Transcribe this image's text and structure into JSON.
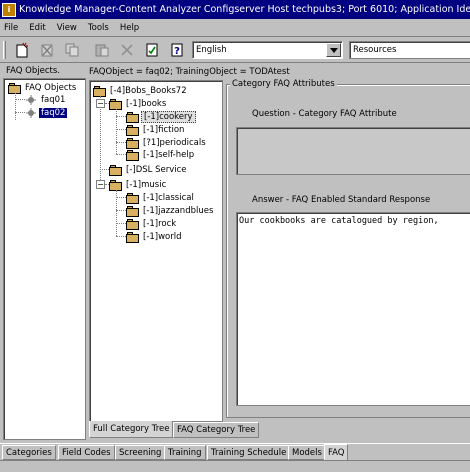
{
  "window": {
    "title": "Knowledge Manager-Content Analyzer Configserver Host techpubs3; Port 6010; Application Iden"
  },
  "menu": [
    "File",
    "Edit",
    "View",
    "Tools",
    "Help"
  ],
  "toolbar": {
    "icons": [
      "new-icon",
      "delete-icon",
      "copy-icon",
      "paste-icon",
      "cut-icon",
      "refresh-icon",
      "help-icon"
    ],
    "language": "English",
    "resources": "Resources"
  },
  "left": {
    "label": "FAQ Objects.",
    "root": "FAQ Objects",
    "items": [
      "faq01",
      "faq02"
    ]
  },
  "header": "FAQObject = faq02; TrainingObject = TODAtest",
  "tree": {
    "root": "[-4]Bobs_Books72",
    "books": "[-1]books",
    "book_items": [
      "[-1]cookery",
      "[-1]fiction",
      "[?1]periodicals",
      "[-1]self-help"
    ],
    "dsl": "[-]DSL Service",
    "music": "[-1]music",
    "music_items": [
      "[-1]classical",
      "[-1]jazzandblues",
      "[-1]rock",
      "[-1]world"
    ]
  },
  "attributes": {
    "legend": "Category FAQ Attributes",
    "question_label": "Question - Category FAQ Attribute",
    "question_value": "",
    "answer_label": "Answer - FAQ Enabled Standard Response",
    "answer_value": "Our cookbooks are catalogued by region,"
  },
  "inner_tabs": [
    "Full Category Tree",
    "FAQ Category Tree"
  ],
  "bottom_tabs": [
    "Categories",
    "Field Codes",
    "Screening",
    "Training",
    "Training Schedule",
    "Models",
    "FAQ"
  ]
}
